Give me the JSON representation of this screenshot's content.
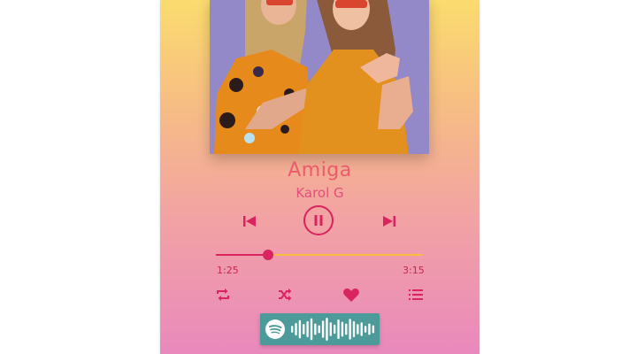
{
  "player": {
    "track_title": "Amiga",
    "artist": "Karol G",
    "state": "playing",
    "progress_fraction": 0.25,
    "time_current": "1:25",
    "time_total": "3:15",
    "liked": true
  },
  "icons": {
    "previous": "skip-previous-icon",
    "play_pause": "pause-icon",
    "next": "skip-next-icon",
    "repeat": "repeat-icon",
    "shuffle": "shuffle-icon",
    "like": "heart-icon",
    "queue": "queue-list-icon",
    "spotify": "spotify-logo-icon"
  },
  "colors": {
    "accent": "#d9245f",
    "title": "#ec5b6b",
    "progress_remaining": "#f6bf3c",
    "spotify_code_bg": "#4d9a9a"
  },
  "spotify_code": {
    "bar_levels": [
      0.3,
      0.55,
      0.8,
      0.45,
      0.7,
      0.95,
      0.5,
      0.35,
      0.75,
      1.0,
      0.6,
      0.4,
      0.85,
      0.65,
      0.5,
      0.9,
      0.7,
      0.45,
      0.6,
      0.3,
      0.5,
      0.35
    ]
  }
}
